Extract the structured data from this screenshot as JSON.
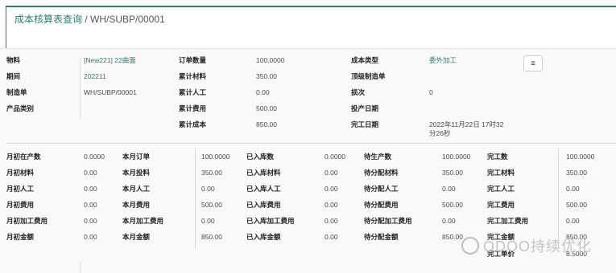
{
  "breadcrumb": {
    "parent": "成本核算表查询",
    "current": "WH/SUBP/00001"
  },
  "header": {
    "col1": [
      {
        "label": "物料",
        "value": "[New221] 22曲面"
      },
      {
        "label": "期间",
        "value": "202211"
      },
      {
        "label": "制造单",
        "value": "WH/SUBP/00001"
      },
      {
        "label": "产品类别",
        "value": ""
      }
    ],
    "col2": [
      {
        "label": "订单数量",
        "value": "100.0000"
      },
      {
        "label": "累计材料",
        "value": "350.00"
      },
      {
        "label": "累计人工",
        "value": "0.00"
      },
      {
        "label": "累计费用",
        "value": "500.00"
      },
      {
        "label": "累计成本",
        "value": "850.00"
      }
    ],
    "col3": [
      {
        "label": "成本类型",
        "value": "委外加工"
      },
      {
        "label": "顶级制造单",
        "value": ""
      },
      {
        "label": "损次",
        "value": "0"
      },
      {
        "label": "投产日期",
        "value": ""
      },
      {
        "label": "完工日期",
        "value": "2022年11月22日 17时32分26秒"
      }
    ]
  },
  "grid": {
    "rows": [
      [
        [
          "月初在产数",
          "0.0000"
        ],
        [
          "本月订单",
          "100.0000"
        ],
        [
          "已入库数",
          "0.0000"
        ],
        [
          "待生产数",
          "100.0000"
        ],
        [
          "完工数",
          "100.0000"
        ]
      ],
      [
        [
          "月初材料",
          "0.00"
        ],
        [
          "本月投料",
          "350.00"
        ],
        [
          "已入库材料",
          "0.00"
        ],
        [
          "待分配材料",
          "350.00"
        ],
        [
          "完工材料",
          "350.00"
        ]
      ],
      [
        [
          "月初人工",
          "0.00"
        ],
        [
          "本月人工",
          "0.00"
        ],
        [
          "已入库人工",
          "0.00"
        ],
        [
          "待分配人工",
          "0.00"
        ],
        [
          "完工人工",
          "0.00"
        ]
      ],
      [
        [
          "月初费用",
          "0.00"
        ],
        [
          "本月费用",
          "500.00"
        ],
        [
          "已入库费用",
          "0.00"
        ],
        [
          "待分配费用",
          "500.00"
        ],
        [
          "完工费用",
          "500.00"
        ]
      ],
      [
        [
          "月初加工费用",
          "0.00"
        ],
        [
          "本月加工费用",
          "0.00"
        ],
        [
          "已入库加工费用",
          "0.00"
        ],
        [
          "待分配加工费用",
          "0.00"
        ],
        [
          "完工加工费用",
          "0.00"
        ]
      ],
      [
        [
          "月初金额",
          "0.00"
        ],
        [
          "本月金额",
          "850.00"
        ],
        [
          "已入库金额",
          "0.00"
        ],
        [
          "待分配金额",
          "850.00"
        ],
        [
          "完工金额",
          "850.00"
        ]
      ]
    ],
    "extra": {
      "label": "完工单价",
      "value": "8.5000"
    }
  },
  "watermark": {
    "text": "ODOO持续优化",
    "icon": "wechat-icon"
  },
  "colors": {
    "accent": "#2f7d6f"
  }
}
